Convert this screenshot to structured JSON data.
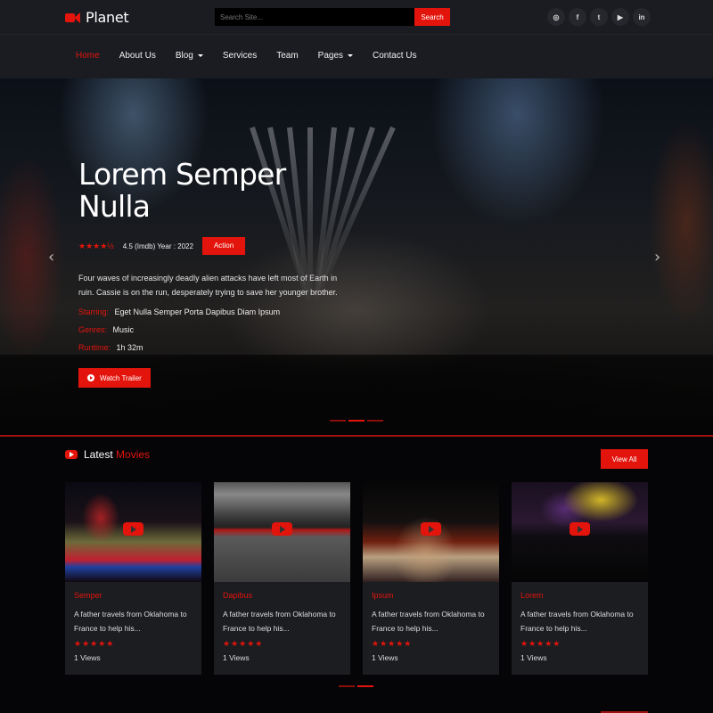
{
  "brand": {
    "name": "Planet",
    "icon": "video-camera-icon",
    "accent_color": "#e3140c"
  },
  "search": {
    "placeholder": "Search Site...",
    "button_label": "Search"
  },
  "socials": [
    {
      "name": "instagram",
      "glyph": "◎"
    },
    {
      "name": "facebook",
      "glyph": "f"
    },
    {
      "name": "twitter",
      "glyph": "t"
    },
    {
      "name": "youtube",
      "glyph": "▶"
    },
    {
      "name": "linkedin",
      "glyph": "in"
    }
  ],
  "nav": {
    "items": [
      {
        "label": "Home",
        "active": true,
        "dropdown": false
      },
      {
        "label": "About Us",
        "active": false,
        "dropdown": false
      },
      {
        "label": "Blog",
        "active": false,
        "dropdown": true
      },
      {
        "label": "Services",
        "active": false,
        "dropdown": false
      },
      {
        "label": "Team",
        "active": false,
        "dropdown": false
      },
      {
        "label": "Pages",
        "active": false,
        "dropdown": true
      },
      {
        "label": "Contact Us",
        "active": false,
        "dropdown": false
      }
    ]
  },
  "hero": {
    "title": "Lorem Semper Nulla",
    "rating_stars": 4.5,
    "rating_stars_text": "★★★★½",
    "meta": "4.5 (Imdb) Year : 2022",
    "genre_badge": "Action",
    "description": "Four waves of increasingly deadly alien attacks have left most of Earth in ruin. Cassie is on the run, desperately trying to save her younger brother.",
    "starring_label": "Starring:",
    "starring_value": "Eget Nulla Semper Porta Dapibus Diam Ipsum",
    "genres_label": "Genres:",
    "genres_value": "Music",
    "runtime_label": "Runtime:",
    "runtime_value": "1h 32m",
    "trailer_button": "Watch Trailer",
    "prev_arrow": "‹",
    "next_arrow": "›",
    "slides_total": 3,
    "slide_active": 2
  },
  "latest": {
    "title_main": "Latest",
    "title_highlight": "Movies",
    "view_all": "View All",
    "movies": [
      {
        "title": "Semper",
        "description": "A father travels from Oklahoma to France to help his...",
        "stars": "★★★★★",
        "rating": 5,
        "views": "1 Views"
      },
      {
        "title": "Dapibus",
        "description": "A father travels from Oklahoma to France to help his...",
        "stars": "★★★★★",
        "rating": 5,
        "views": "1 Views"
      },
      {
        "title": "Ipsum",
        "description": "A father travels from Oklahoma to France to help his...",
        "stars": "★★★★★",
        "rating": 5,
        "views": "1 Views"
      },
      {
        "title": "Lorem",
        "description": "A father travels from Oklahoma to France to help his...",
        "stars": "★★★★★",
        "rating": 5,
        "views": "1 Views"
      }
    ],
    "pager_total": 2,
    "pager_active": 2
  }
}
